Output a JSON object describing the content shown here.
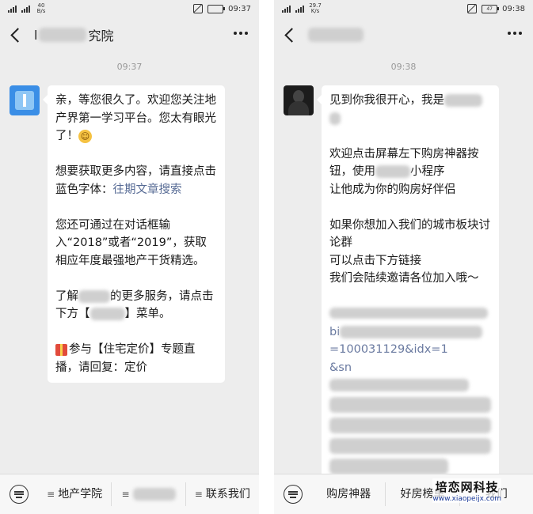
{
  "left": {
    "status": {
      "network_speed": "40\nB/s",
      "time": "09:37"
    },
    "header": {
      "title_prefix": "l",
      "title_suffix": "究院"
    },
    "timestamp": "09:37",
    "message": {
      "p1": "亲，等您很久了。欢迎您关注地产界第一学习平台。您太有眼光了！",
      "p2_text": "想要获取更多内容，请直接点击蓝色字体：",
      "p2_link": "往期文章搜索",
      "p3": "您还可通过在对话框输入“2018”或者“2019”，获取相应年度最强地产干货精选。",
      "p4a": "了解",
      "p4b": "的更多服务，请点击下方【",
      "p4c": "】菜单。",
      "p5": "参与【住宅定价】专题直播，请回复：定价"
    },
    "menu": {
      "item1": "地产学院",
      "item3": "联系我们"
    }
  },
  "right": {
    "status": {
      "network_speed": "29.7\nK/s",
      "battery": "47",
      "time": "09:38"
    },
    "timestamp": "09:38",
    "message": {
      "p1": "见到你我很开心，我是",
      "p2a": "欢迎点击屏幕左下购房神器按钮，使用",
      "p2b": "小程序",
      "p2c": "让他成为你的购房好伴侣",
      "p3a": "如果你想加入我们的城市板块讨论群",
      "p3b": "可以点击下方链接",
      "p3c": "我们会陆续邀请各位加入哦～",
      "link_line2": "bi",
      "link_line3": "=100031129&idx=1",
      "link_line4": "&sn"
    },
    "menu": {
      "item1": "购房神器",
      "item2": "好房榜单",
      "item3": "我们"
    }
  },
  "watermark": {
    "title": "培恋网科技",
    "url": "www.xiaopeijx.com"
  }
}
